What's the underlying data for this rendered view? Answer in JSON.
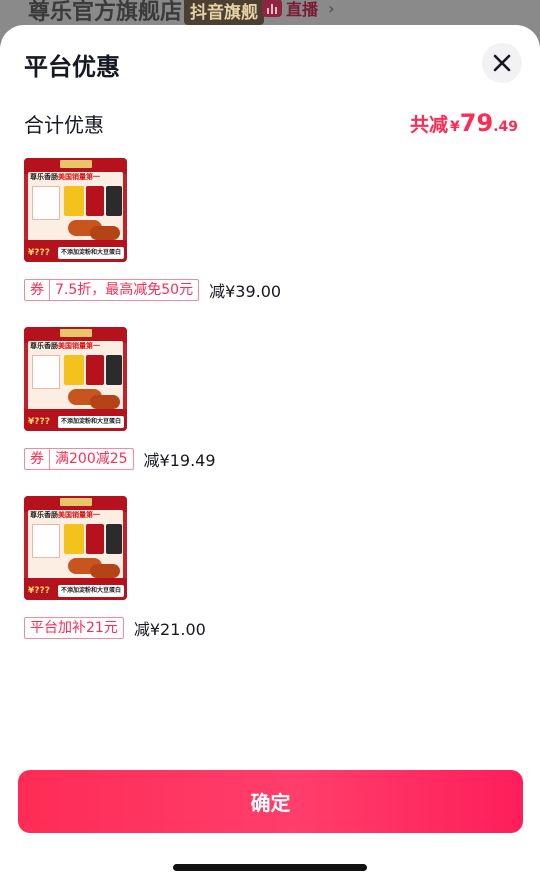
{
  "background": {
    "store_name": "尊乐官方旗舰店",
    "badge": "抖音旗舰",
    "live_label": "直播",
    "arrow": "›"
  },
  "sheet": {
    "title": "平台优惠",
    "close_icon": "close-icon",
    "total": {
      "label": "合计优惠",
      "prefix": "共减",
      "currency": "¥",
      "amount_int": "79",
      "amount_dec": ".49"
    }
  },
  "items": [
    {
      "thumb": {
        "brand_text": "尊乐香肠",
        "highlight_text": "美国销量第一",
        "price_text": "¥???",
        "tag_text": "不添加淀粉和大豆蛋白"
      },
      "coupon": {
        "tag": "券",
        "text": "7.5折，最高减免50元"
      },
      "saving": "减¥39.00"
    },
    {
      "thumb": {
        "brand_text": "尊乐香肠",
        "highlight_text": "美国销量第一",
        "price_text": "¥???",
        "tag_text": "不添加淀粉和大豆蛋白"
      },
      "coupon": {
        "tag": "券",
        "text": "满200减25"
      },
      "saving": "减¥19.49"
    },
    {
      "thumb": {
        "brand_text": "尊乐香肠",
        "highlight_text": "美国销量第一",
        "price_text": "¥???",
        "tag_text": "不添加淀粉和大豆蛋白"
      },
      "coupon": {
        "tag": "",
        "text": "平台加补21元"
      },
      "saving": "减¥21.00"
    }
  ],
  "confirm_label": "确定",
  "colors": {
    "accent": "#fe2c55",
    "text": "#161823",
    "chip_border": "#f48a9e"
  }
}
